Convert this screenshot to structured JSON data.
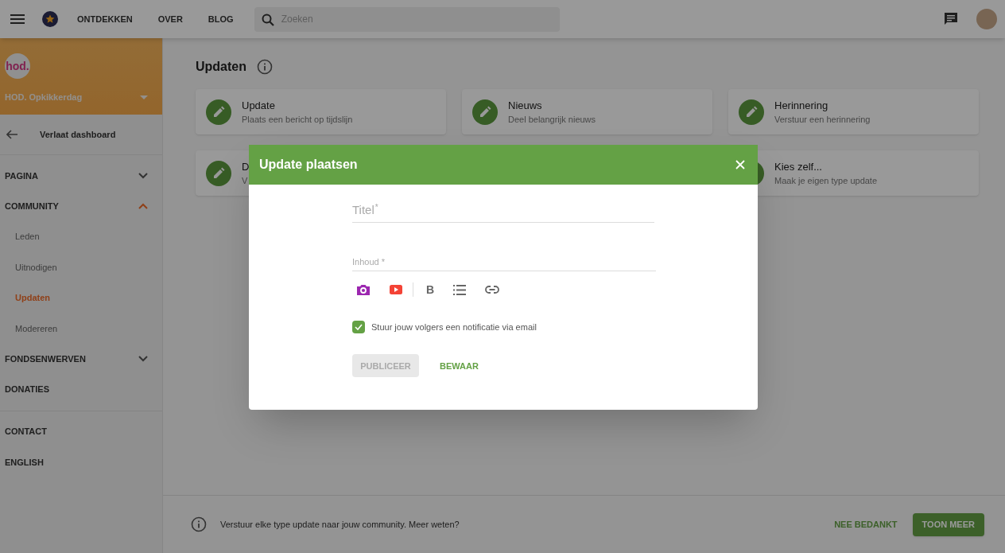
{
  "topbar": {
    "nav_links": [
      "ONTDEKKEN",
      "OVER",
      "BLOG"
    ],
    "search": {
      "placeholder": "Zoeken"
    }
  },
  "sidebar": {
    "logo": "hod.",
    "org_name": "HOD. Opkikkerdag",
    "back_link": "Verlaat dashboard",
    "main_menu": [
      {
        "label": "PAGINA",
        "kind": "section",
        "expanded": false
      },
      {
        "label": "COMMUNITY",
        "kind": "section",
        "expanded": true,
        "children": [
          {
            "label": "Leden",
            "selected": false
          },
          {
            "label": "Uitnodigen",
            "selected": false
          },
          {
            "label": "Updaten",
            "selected": true
          },
          {
            "label": "Modereren",
            "selected": false
          }
        ]
      },
      {
        "label": "FONDSENWERVEN",
        "kind": "section",
        "expanded": false
      },
      {
        "label": "DONATIES",
        "kind": "link"
      }
    ],
    "footer_menu": [
      "CONTACT",
      "ENGLISH"
    ]
  },
  "main": {
    "title": "Updaten",
    "cards": [
      {
        "title": "Update",
        "subtitle": "Plaats een bericht op tijdslijn"
      },
      {
        "title": "Nieuws",
        "subtitle": "Deel belangrijk nieuws"
      },
      {
        "title": "Herinnering",
        "subtitle": "Verstuur een herinnering"
      },
      {
        "title": "D",
        "subtitle": "V"
      },
      {
        "title": "Kies zelf...",
        "subtitle": "Maak je eigen type update"
      }
    ],
    "banner": {
      "text": "Verstuur elke type update naar jouw community. Meer weten?",
      "dismiss": "NEE BEDANKT",
      "more": "TOON MEER"
    }
  },
  "dialog": {
    "title": "Update plaatsen",
    "fields": [
      {
        "kind": "title",
        "label": "Titel",
        "required_mark": "*"
      },
      {
        "kind": "content",
        "label": "Inhoud",
        "required_mark": "*"
      }
    ],
    "toolbar": {
      "bold": "B"
    },
    "notify": {
      "label": "Stuur jouw volgers een notificatie via email",
      "checked": true
    },
    "publish": {
      "label": "PUBLICEER",
      "disabled": true
    },
    "save": {
      "label": "BEWAAR"
    }
  }
}
